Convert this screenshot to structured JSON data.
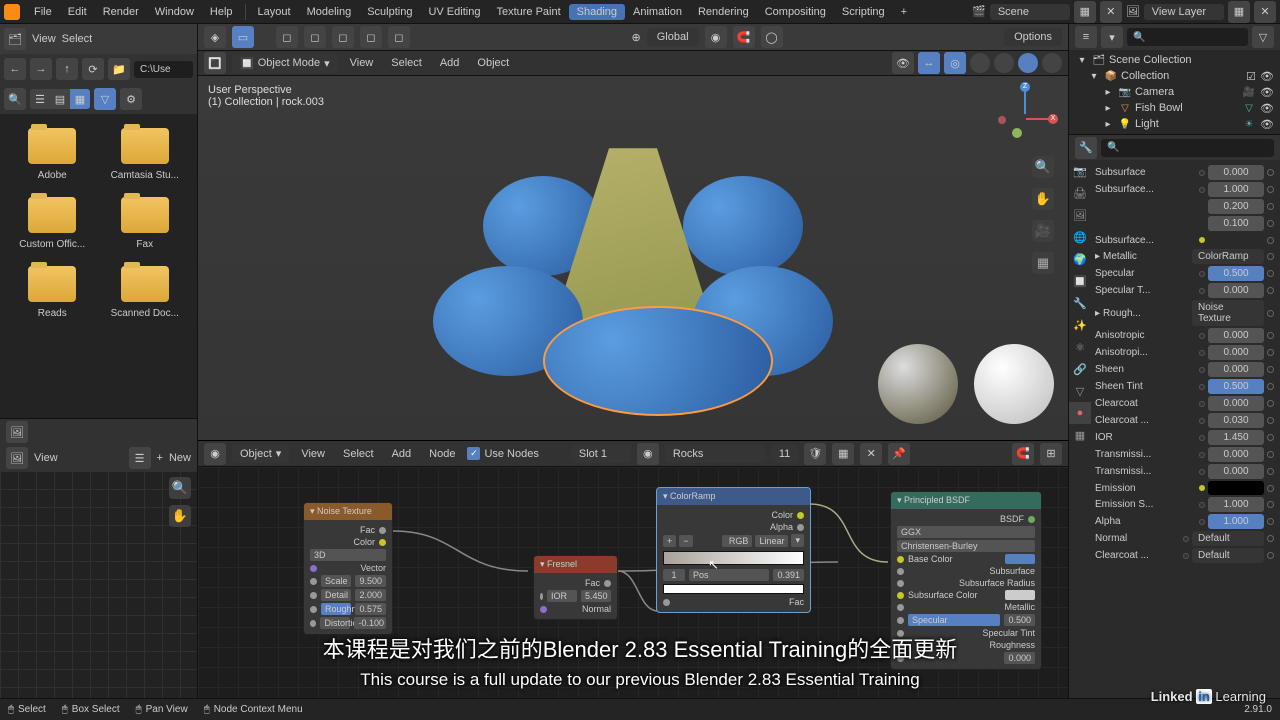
{
  "top_menu": {
    "file": "File",
    "edit": "Edit",
    "render": "Render",
    "window": "Window",
    "help": "Help"
  },
  "workspaces": {
    "layout": "Layout",
    "modeling": "Modeling",
    "sculpting": "Sculpting",
    "uvediting": "UV Editing",
    "texturepaint": "Texture Paint",
    "shading": "Shading",
    "animation": "Animation",
    "rendering": "Rendering",
    "compositing": "Compositing",
    "scripting": "Scripting"
  },
  "scene_name": "Scene",
  "view_layer": "View Layer",
  "filebrowser": {
    "view": "View",
    "select": "Select",
    "path": "C:\\Use",
    "folders": [
      "Adobe",
      "Camtasia Stu...",
      "Custom Offic...",
      "Fax",
      "Reads",
      "Scanned Doc..."
    ]
  },
  "viewport": {
    "mode": "Object Mode",
    "menus": {
      "view": "View",
      "select": "Select",
      "add": "Add",
      "object": "Object"
    },
    "overlay_line1": "User Perspective",
    "overlay_line2": "(1) Collection | rock.003",
    "transform": "Global",
    "options": "Options"
  },
  "node_editor": {
    "type_label": "Object",
    "menus": {
      "view": "View",
      "select": "Select",
      "add": "Add",
      "node": "Node"
    },
    "use_nodes": "Use Nodes",
    "slot": "Slot 1",
    "material": "Rocks",
    "users": "11",
    "nodes": {
      "noise": {
        "title": "Noise Texture",
        "out_fac": "Fac",
        "out_color": "Color",
        "dim": "3D",
        "vector": "Vector",
        "scale_l": "Scale",
        "scale_v": "9.500",
        "detail_l": "Detail",
        "detail_v": "2.000",
        "rough_l": "Roughness",
        "rough_v": "0.575",
        "dist_l": "Distortion",
        "dist_v": "-0.100"
      },
      "fresnel": {
        "title": "Fresnel",
        "fac": "Fac",
        "ior_l": "IOR",
        "ior_v": "5.450",
        "normal": "Normal"
      },
      "ramp": {
        "title": "ColorRamp",
        "color": "Color",
        "alpha": "Alpha",
        "mode1": "RGB",
        "mode2": "Linear",
        "handle_idx": "1",
        "handle_pos_l": "Pos",
        "handle_pos_v": "0.391",
        "fac": "Fac"
      },
      "bsdf": {
        "title": "Principled BSDF",
        "out": "BSDF",
        "dist": "GGX",
        "sss": "Christensen-Burley",
        "base_color": "Base Color",
        "subsurface": "Subsurface",
        "subsurface_r": "Subsurface Radius",
        "subsurface_c": "Subsurface Color",
        "metallic": "Metallic",
        "specular": "Specular",
        "specular_v": "0.500",
        "spectint": "Specular Tint",
        "roughness": "Roughness",
        "aniso_v": "0.000"
      }
    }
  },
  "outliner": {
    "scene_collection": "Scene Collection",
    "collection": "Collection",
    "items": [
      "Camera",
      "Fish Bowl",
      "Light"
    ]
  },
  "properties": [
    {
      "label": "Subsurface",
      "value": "0.000",
      "dot": true
    },
    {
      "label": "Subsurface...",
      "value": "1.000",
      "dot": true
    },
    {
      "label": "",
      "value": "0.200"
    },
    {
      "label": "",
      "value": "0.100"
    },
    {
      "label": "Subsurface...",
      "dot": "yellow",
      "swatch": "#2a2a2a"
    },
    {
      "label": "Metallic",
      "text": "ColorRamp",
      "chev": true
    },
    {
      "label": "Specular",
      "value": "0.500",
      "dot": true,
      "blue": true
    },
    {
      "label": "Specular T...",
      "value": "0.000",
      "dot": true
    },
    {
      "label": "Rough...",
      "text": "Noise Texture",
      "chev": true
    },
    {
      "label": "Anisotropic",
      "value": "0.000",
      "dot": true
    },
    {
      "label": "Anisotropi...",
      "value": "0.000",
      "dot": true
    },
    {
      "label": "Sheen",
      "value": "0.000",
      "dot": true
    },
    {
      "label": "Sheen Tint",
      "value": "0.500",
      "dot": true,
      "blue": true
    },
    {
      "label": "Clearcoat",
      "value": "0.000",
      "dot": true
    },
    {
      "label": "Clearcoat ...",
      "value": "0.030",
      "dot": true
    },
    {
      "label": "IOR",
      "value": "1.450",
      "dot": true
    },
    {
      "label": "Transmissi...",
      "value": "0.000",
      "dot": true
    },
    {
      "label": "Transmissi...",
      "value": "0.000",
      "dot": true
    },
    {
      "label": "Emission",
      "dot": "yellow",
      "swatch": "#000"
    },
    {
      "label": "Emission S...",
      "value": "1.000",
      "dot": true
    },
    {
      "label": "Alpha",
      "value": "1.000",
      "dot": true,
      "blue": true
    },
    {
      "label": "Normal",
      "text": "Default",
      "dot": true
    },
    {
      "label": "Clearcoat ...",
      "text": "Default",
      "dot": true
    }
  ],
  "uv_editor": {
    "view": "View",
    "new": "New"
  },
  "status_bar": {
    "select": "Select",
    "box_select": "Box Select",
    "pan_view": "Pan View",
    "context_menu": "Node Context Menu"
  },
  "version": "2.91.0",
  "subtitle_cn": "本课程是对我们之前的Blender 2.83 Essential Training的全面更新",
  "subtitle_en": "This course is a full update to our previous Blender 2.83 Essential Training",
  "watermark": "Linked in Learning"
}
